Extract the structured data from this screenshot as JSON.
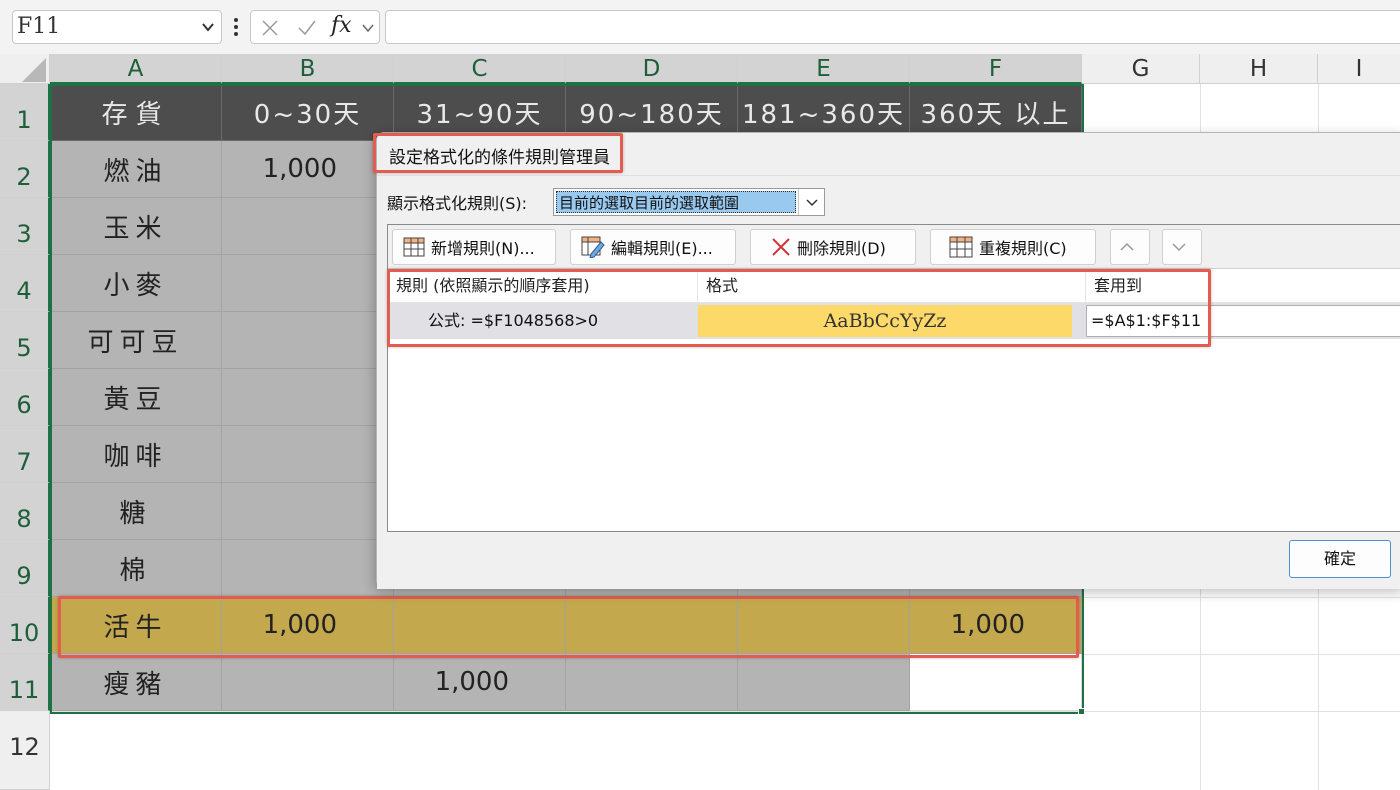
{
  "formula_bar": {
    "name_box": "F11",
    "formula": ""
  },
  "columns": [
    "A",
    "B",
    "C",
    "D",
    "E",
    "F",
    "G",
    "H",
    "I"
  ],
  "rows": [
    "1",
    "2",
    "3",
    "4",
    "5",
    "6",
    "7",
    "8",
    "9",
    "10",
    "11",
    "12"
  ],
  "sheet": {
    "header": [
      "存貨",
      "0~30天",
      "31~90天",
      "90~180天",
      "181~360天",
      "360天 以上"
    ],
    "items": [
      "燃油",
      "玉米",
      "小麥",
      "可可豆",
      "黃豆",
      "咖啡",
      "糖",
      "棉",
      "活牛",
      "瘦豬"
    ],
    "values": {
      "B2": "1,000",
      "B10": "1,000",
      "F10": "1,000",
      "C11": "1,000"
    }
  },
  "dialog": {
    "title": "設定格式化的條件規則管理員",
    "show_rules_label": "顯示格式化規則(S):",
    "show_rules_value": "目前的選取目前的選取範圍",
    "buttons": {
      "new_rule": "新增規則(N)...",
      "edit_rule": "編輯規則(E)...",
      "delete_rule": "刪除規則(D)",
      "duplicate_rule": "重複規則(C)"
    },
    "list_headers": {
      "rule": "規則 (依照顯示的順序套用)",
      "format": "格式",
      "applies_to": "套用到"
    },
    "rule": {
      "formula": "公式: =$F1048568>0",
      "preview": "AaBbCcYyZz",
      "applies_to": "=$A$1:$F$11"
    },
    "ok_label": "確定"
  },
  "colors": {
    "header_fill": "#4d4d4d",
    "body_fill": "#b4b4b4",
    "highlight_fill": "#c4a84d",
    "preview_fill": "#fdd969",
    "annotation": "#e35c4f",
    "selection": "#1e7145"
  }
}
